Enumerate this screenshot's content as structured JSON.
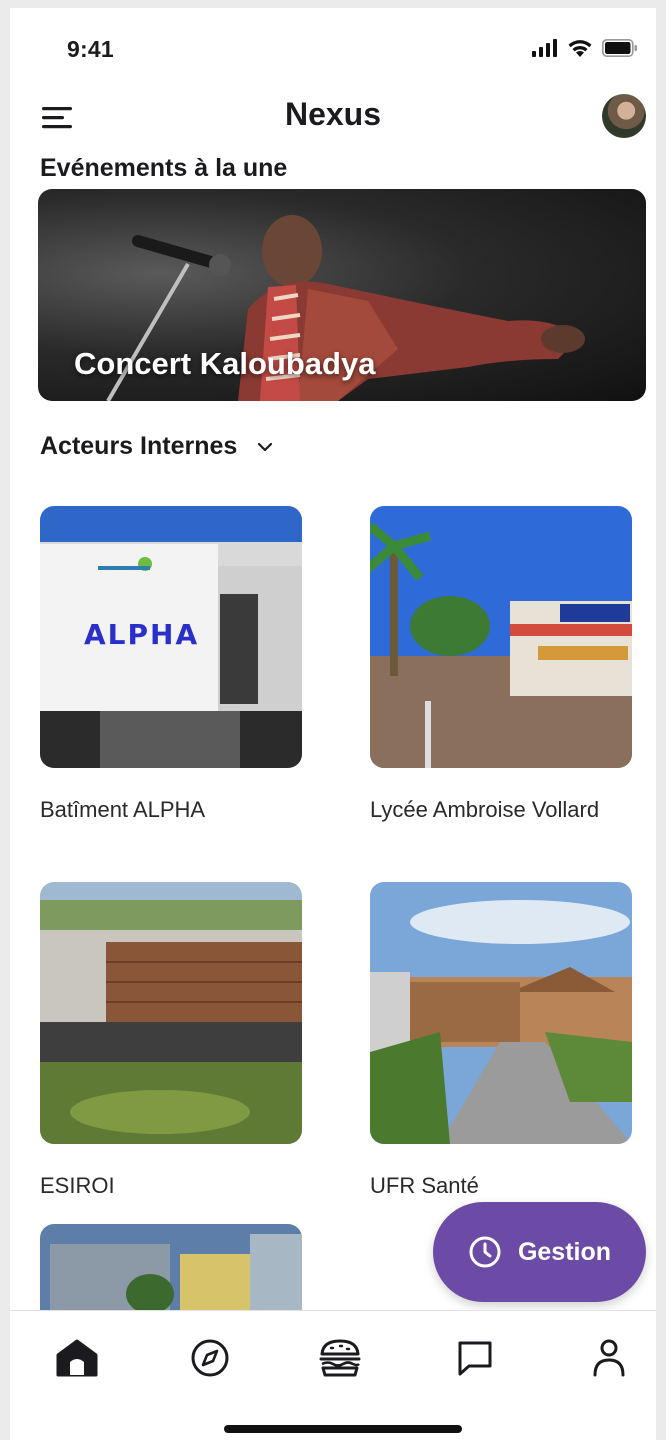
{
  "status_bar": {
    "time": "9:41"
  },
  "app_bar": {
    "title": "Nexus"
  },
  "featured": {
    "section_title": "Evénements à la une",
    "event_title": "Concert Kaloubadya"
  },
  "actors": {
    "filter_label": "Acteurs Internes",
    "items": [
      {
        "name": "Batîment ALPHA"
      },
      {
        "name": "Lycée Ambroise Vollard"
      },
      {
        "name": "ESIROI"
      },
      {
        "name": "UFR Santé"
      },
      {
        "name": ""
      }
    ]
  },
  "fab": {
    "label": "Gestion",
    "icon": "clock-icon"
  },
  "bottom_nav": {
    "items": [
      "home-icon",
      "compass-icon",
      "burger-icon",
      "chat-icon",
      "profile-icon"
    ],
    "active": "home-icon"
  },
  "colors": {
    "accent": "#6b4ba6",
    "text": "#1b1b1f"
  }
}
